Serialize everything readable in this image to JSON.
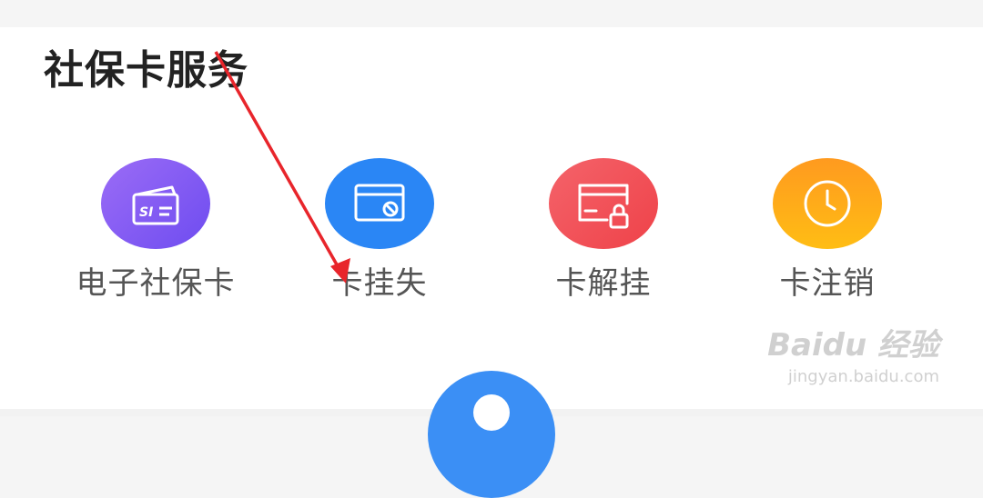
{
  "section": {
    "title": "社保卡服务"
  },
  "services": [
    {
      "label": "电子社保卡",
      "icon": "social-security-card-icon",
      "color": "#7f56f0",
      "icon_text": "SI"
    },
    {
      "label": "卡挂失",
      "icon": "card-block-icon",
      "color": "#2a86f5"
    },
    {
      "label": "卡解挂",
      "icon": "card-unlock-icon",
      "color": "#f25359"
    },
    {
      "label": "卡注销",
      "icon": "clock-icon",
      "color": "#ffa31a"
    }
  ],
  "watermark": {
    "brand": "Baidu 经验",
    "url": "jingyan.baidu.com"
  },
  "colors": {
    "annotation_arrow": "#e8252b",
    "fab": "#3b8ff5"
  }
}
